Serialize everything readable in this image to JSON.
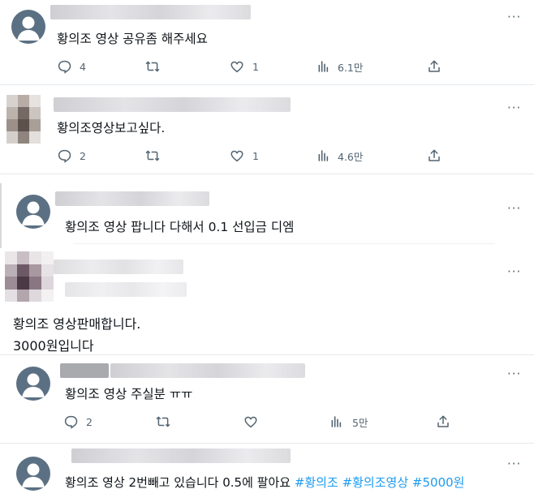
{
  "posts": [
    {
      "text": "황의조 영상 공유좀 해주세요",
      "replies": "4",
      "reposts": "",
      "likes": "1",
      "views": "6.1만"
    },
    {
      "text": "황의조영상보고싶다.",
      "replies": "2",
      "reposts": "",
      "likes": "1",
      "views": "4.6만"
    },
    {
      "text": "황의조 영상 팝니다 다해서 0.1 선입금 디엠"
    },
    {
      "line1": "황의조 영상판매합니다.",
      "line2": "3000원입니다"
    },
    {
      "text": "황의조 영상 주실분 ㅠㅠ",
      "replies": "2",
      "reposts": "",
      "likes": "",
      "views": "5만"
    },
    {
      "text": "황의조 영상 2번빼고 있습니다 0.5에 팔아요 ",
      "hashtags": [
        "#황의조",
        "#황의조영상",
        "#5000원"
      ]
    }
  ],
  "more_label": "···",
  "colors": {
    "text": "#0f1419",
    "muted": "#536471",
    "link": "#1d9bf0",
    "divider": "#e6e9ec"
  }
}
